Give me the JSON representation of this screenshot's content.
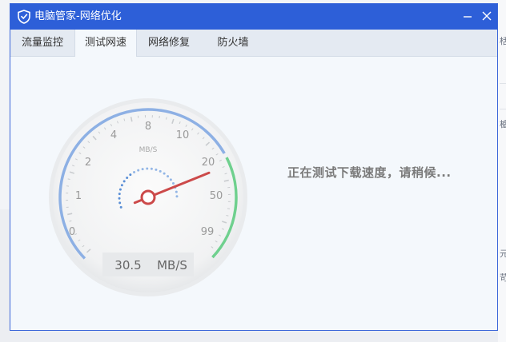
{
  "window": {
    "title": "电脑管家-网络优化",
    "minimize_icon": "minimize-icon",
    "close_icon": "close-icon"
  },
  "tabs": [
    {
      "label": "流量监控",
      "active": false
    },
    {
      "label": "测试网速",
      "active": true
    },
    {
      "label": "网络修复",
      "active": false
    },
    {
      "label": "防火墙",
      "active": false
    }
  ],
  "gauge": {
    "unit_label": "MB/S",
    "scale_labels": [
      "0",
      "1",
      "2",
      "4",
      "8",
      "10",
      "20",
      "50",
      "99"
    ],
    "readout_value": "30.5",
    "readout_unit": "MB/S",
    "needle_value": 30.5
  },
  "status_text": "正在测试下载速度，请稍候...",
  "colors": {
    "title_bar": "#2d5fd8",
    "arc_blue": "#8db0e4",
    "arc_green": "#6fd08e",
    "needle_red": "#cc4a4a"
  },
  "background_window": {
    "chars": [
      "栝",
      "樝",
      "元",
      "苛"
    ]
  }
}
